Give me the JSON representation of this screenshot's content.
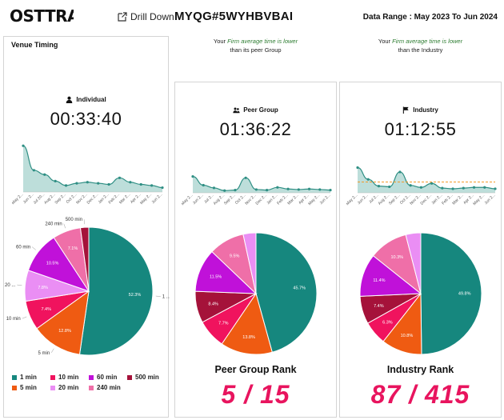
{
  "header": {
    "logo": "OSTTRA",
    "drill_down": "Drill Down",
    "entity_id": "MYQG#5WYHBVBAI",
    "date_range": "Data Range : May 2023 To Jun 2024"
  },
  "notes": {
    "peer": {
      "pre": "Your ",
      "highlight": "Firm average time is lower",
      "line2": "than its peer Group"
    },
    "industry": {
      "pre": "Your ",
      "highlight": "Firm average time is lower",
      "line2": "than the Industry"
    }
  },
  "panels": {
    "venue_timing_title": "Venue Timing",
    "individual": {
      "label": "Individual",
      "time": "00:33:40"
    },
    "peer": {
      "label": "Peer Group",
      "time": "01:36:22",
      "rank_title": "Peer Group Rank",
      "rank": "5 / 15"
    },
    "industry": {
      "label": "Industry",
      "time": "01:12:55",
      "rank_title": "Industry Rank",
      "rank": "87 / 415"
    }
  },
  "colors": {
    "1 min": "#16877e",
    "5 min": "#ef5b12",
    "10 min": "#f0135e",
    "20 min": "#ea8ef4",
    "60 min": "#c011d9",
    "240 min": "#ef6fa8",
    "500 min": "#a5123a",
    "spark_line": "#2f8f84",
    "spark_fill": "#a7d3ce",
    "avg_line": "#f39a2b"
  },
  "legend": [
    {
      "label": "1 min",
      "color": "#16877e"
    },
    {
      "label": "10 min",
      "color": "#f0135e"
    },
    {
      "label": "60 min",
      "color": "#c011d9"
    },
    {
      "label": "500 min",
      "color": "#a5123a"
    },
    {
      "label": "5 min",
      "color": "#ef5b12"
    },
    {
      "label": "20 min",
      "color": "#ea8ef4"
    },
    {
      "label": "240 min",
      "color": "#ef6fa8"
    }
  ],
  "chart_data": [
    {
      "id": "individual-trend",
      "type": "area",
      "x": [
        "May 2...",
        "Jun 2...",
        "Jul 20...",
        "Aug 2...",
        "Sep 2...",
        "Oct 2...",
        "Nov 2...",
        "Dec 2...",
        "Jan 2...",
        "Feb 2...",
        "Mar 2...",
        "Apr 2...",
        "May 2...",
        "Jun 2..."
      ],
      "values": [
        85,
        40,
        32,
        20,
        12,
        16,
        18,
        16,
        14,
        26,
        18,
        14,
        12,
        8
      ],
      "ylim": [
        0,
        100
      ],
      "grid": false
    },
    {
      "id": "peer-trend",
      "type": "area",
      "x": [
        "May 2...",
        "Jun 2...",
        "Jul 2...",
        "Aug 2...",
        "Sep 2...",
        "Oct 2...",
        "Nov 2...",
        "Dec 2...",
        "Jan 2...",
        "Feb 2...",
        "Mar 2...",
        "Apr 2...",
        "May 2...",
        "Jun 2..."
      ],
      "values": [
        60,
        28,
        18,
        8,
        10,
        55,
        12,
        10,
        20,
        14,
        12,
        14,
        12,
        10
      ],
      "ylim": [
        0,
        100
      ],
      "grid": false
    },
    {
      "id": "industry-trend",
      "type": "area",
      "x": [
        "May 2...",
        "Jun 2...",
        "Jul 2...",
        "Aug 2...",
        "Sep 2...",
        "Oct 2...",
        "Nov 2...",
        "Dec 2...",
        "Jan 2...",
        "Feb 2...",
        "Mar 2...",
        "Apr 2...",
        "May 2...",
        "Jun 2..."
      ],
      "values": [
        75,
        40,
        20,
        18,
        62,
        22,
        16,
        28,
        14,
        12,
        14,
        16,
        16,
        12
      ],
      "average": 32,
      "ylim": [
        0,
        100
      ],
      "grid": false
    },
    {
      "id": "individual-pie",
      "type": "pie",
      "slices": [
        {
          "label": "1 min",
          "value": 52.3,
          "text": "52.3%",
          "outer": "1 ..."
        },
        {
          "label": "5 min",
          "value": 12.8,
          "text": "12.8%",
          "outer": "5 min"
        },
        {
          "label": "10 min",
          "value": 7.4,
          "text": "7.4%",
          "outer": "10 min"
        },
        {
          "label": "20 min",
          "value": 7.8,
          "text": "7.8%",
          "outer": "20 ..."
        },
        {
          "label": "60 min",
          "value": 10.5,
          "text": "10.5%",
          "outer": "60 min"
        },
        {
          "label": "240 min",
          "value": 7.1,
          "text": "7.1%",
          "outer": "240 min"
        },
        {
          "label": "500 min",
          "value": 2.1,
          "text": "",
          "outer": "500 min"
        }
      ]
    },
    {
      "id": "peer-pie",
      "type": "pie",
      "slices": [
        {
          "label": "1 min",
          "value": 45.7,
          "text": "45.7%"
        },
        {
          "label": "5 min",
          "value": 13.8,
          "text": "13.8%"
        },
        {
          "label": "10 min",
          "value": 7.7,
          "text": "7.7%"
        },
        {
          "label": "500 min",
          "value": 8.4,
          "text": "8.4%"
        },
        {
          "label": "60 min",
          "value": 11.5,
          "text": "11.5%"
        },
        {
          "label": "240 min",
          "value": 9.5,
          "text": "9.5%"
        },
        {
          "label": "20 min",
          "value": 3.4,
          "text": ""
        }
      ]
    },
    {
      "id": "industry-pie",
      "type": "pie",
      "slices": [
        {
          "label": "1 min",
          "value": 49.8,
          "text": "49.8%"
        },
        {
          "label": "5 min",
          "value": 10.8,
          "text": "10.8%"
        },
        {
          "label": "10 min",
          "value": 6.3,
          "text": "6.3%"
        },
        {
          "label": "500 min",
          "value": 7.4,
          "text": "7.4%"
        },
        {
          "label": "60 min",
          "value": 11.4,
          "text": "11.4%"
        },
        {
          "label": "240 min",
          "value": 10.3,
          "text": "10.3%"
        },
        {
          "label": "20 min",
          "value": 4.0,
          "text": ""
        }
      ]
    }
  ]
}
